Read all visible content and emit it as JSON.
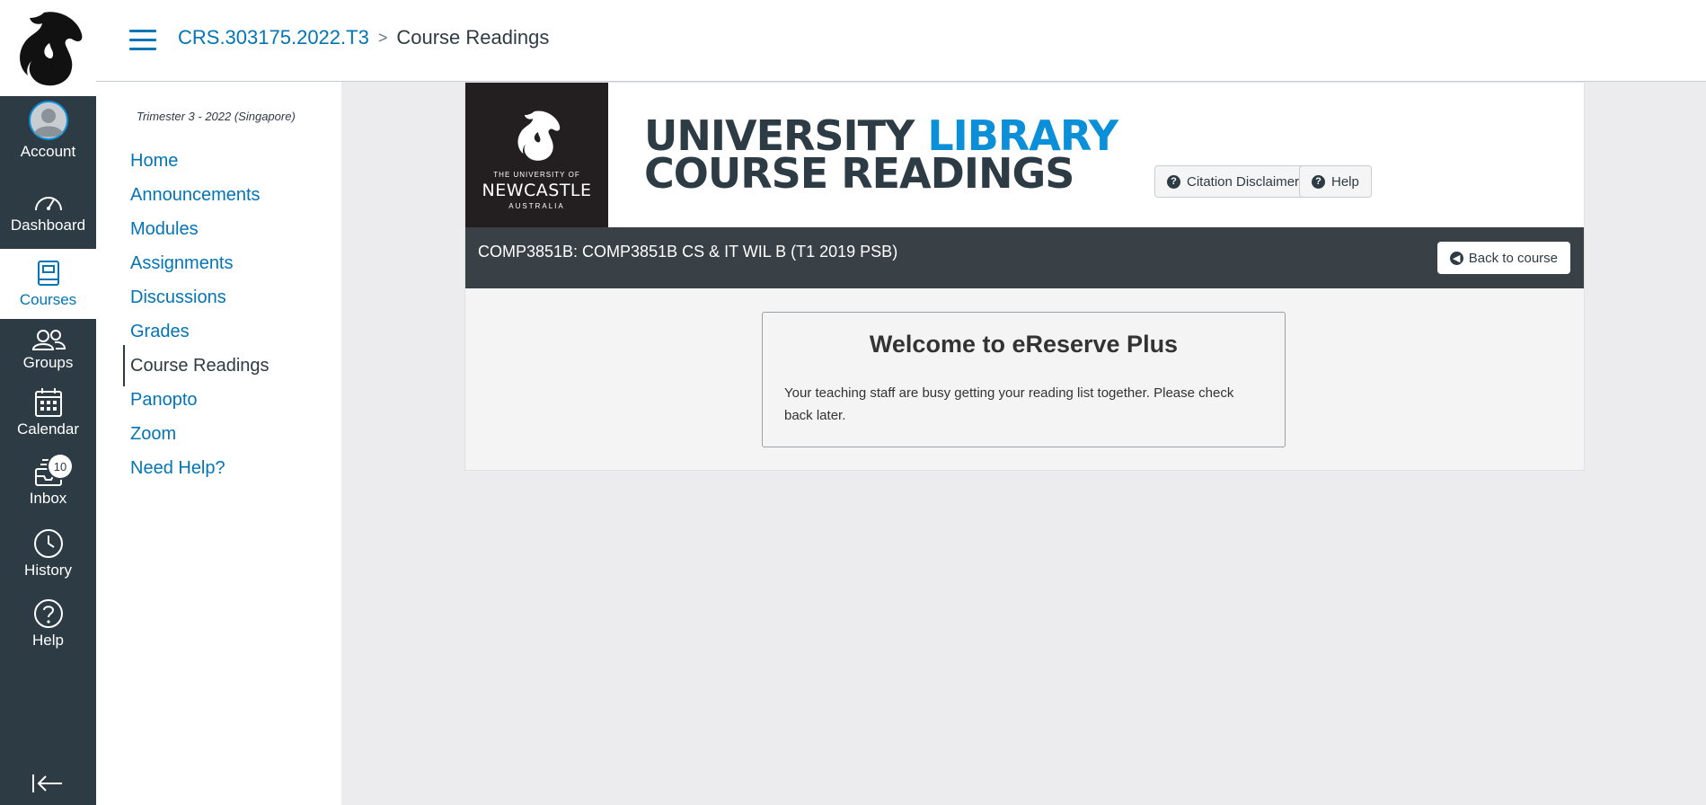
{
  "global_nav": {
    "items": [
      {
        "label": "Account",
        "icon": "avatar"
      },
      {
        "label": "Dashboard",
        "icon": "dashboard-icon"
      },
      {
        "label": "Courses",
        "icon": "courses-icon"
      },
      {
        "label": "Groups",
        "icon": "groups-icon"
      },
      {
        "label": "Calendar",
        "icon": "calendar-icon"
      },
      {
        "label": "Inbox",
        "icon": "inbox-icon",
        "badge": "10"
      },
      {
        "label": "History",
        "icon": "clock-icon"
      },
      {
        "label": "Help",
        "icon": "question-icon"
      }
    ],
    "active": "Courses",
    "colors": {
      "bg": "#2d3b45",
      "active_text": "#0374b5"
    }
  },
  "header": {
    "breadcrumb_course": "CRS.303175.2022.T3",
    "breadcrumb_sep": ">",
    "breadcrumb_current": "Course Readings"
  },
  "course_nav": {
    "term": "Trimester 3 - 2022 (Singapore)",
    "links": [
      "Home",
      "Announcements",
      "Modules",
      "Assignments",
      "Discussions",
      "Grades",
      "Course Readings",
      "Panopto",
      "Zoom",
      "Need Help?"
    ],
    "active": "Course Readings"
  },
  "banner": {
    "logo_line1": "THE UNIVERSITY OF",
    "logo_line2": "NEWCASTLE",
    "logo_line3": "AUSTRALIA",
    "title_part1": "UNIVERSITY ",
    "title_accent": "LIBRARY",
    "title_line2": "COURSE READINGS",
    "citation_button": "Citation Disclaimer",
    "help_button": "Help",
    "accent_color": "#0b8fd8"
  },
  "course_bar": {
    "title": "COMP3851B: COMP3851B CS & IT WIL B (T1 2019 PSB)",
    "back_button": "Back to course"
  },
  "welcome": {
    "title": "Welcome to eReserve Plus",
    "body": "Your teaching staff are busy getting your reading list together. Please check back later."
  }
}
